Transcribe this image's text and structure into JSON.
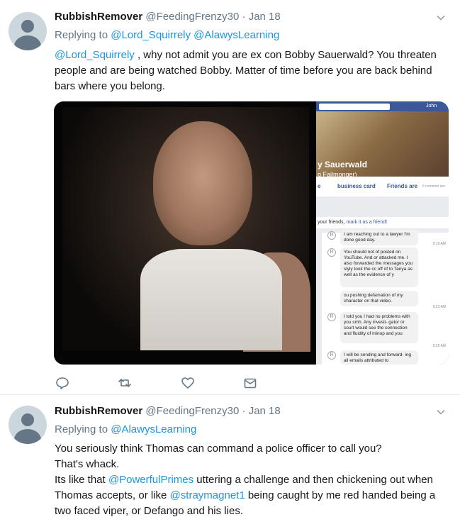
{
  "colors": {
    "link": "#1b95e0",
    "muted": "#657786",
    "text": "#14171a",
    "divider": "#e6ecf0"
  },
  "tweets": [
    {
      "name": "RubbishRemover",
      "handle": "@FeedingFrenzy30",
      "dot": "·",
      "date": "Jan 18",
      "replying_label": "Replying to",
      "replying_to": [
        "@Lord_Squirrely",
        "@AlawysLearning"
      ],
      "mention": "@Lord_Squirrely",
      "text": " , why not admit you are ex con Bobby Sauerwald? You threaten people and are being watched Bobby. Matter of time before you are back behind bars where you belong.",
      "media": {
        "fb_user": "John",
        "fb_name": "y Sauerwald",
        "fb_sub": "g Failmonger)",
        "fb_tabs": [
          "e",
          "business card",
          "Friends are",
          "6 common acc"
        ],
        "fb_friend_text": "your friends,",
        "fb_friend_link": "mark it as a friend!",
        "chat": [
          {
            "text": "I am reaching out to a lawyer I'm done good day.",
            "time": "9:19 AM"
          },
          {
            "text": "You should not of posted on YouTube. And or attacked me. I also forwarded the messages you slyly took the cc off of to Tanya as well as the evidence of y",
            "time": ""
          },
          {
            "text": "ou pushing defamation of my character on that video.",
            "time": "9:23 AM"
          },
          {
            "text": "I told you I had no problems with you smh. Any investi- gator or court would see the connection and fluidity of minop and you",
            "time": "9:25 AM"
          },
          {
            "text": "I will be sending and forward- ing all emails attributed to",
            "time": ""
          }
        ]
      },
      "actions": [
        "reply-icon",
        "retweet-icon",
        "like-icon",
        "message-icon"
      ]
    },
    {
      "name": "RubbishRemover",
      "handle": "@FeedingFrenzy30",
      "dot": "·",
      "date": "Jan 18",
      "replying_label": "Replying to",
      "replying_to": [
        "@AlawysLearning"
      ],
      "line1": "You seriously think Thomas can command a police officer to call you?",
      "line2": "That's whack.",
      "line3_a": "Its like that ",
      "line3_mention1": "@PowerfulPrimes",
      "line3_b": " uttering a challenge and then chickening out when Thomas accepts, or like ",
      "line3_mention2": "@straymagnet1",
      "line3_c": " being caught by me red handed being a two faced viper, or Defango and his lies."
    }
  ]
}
